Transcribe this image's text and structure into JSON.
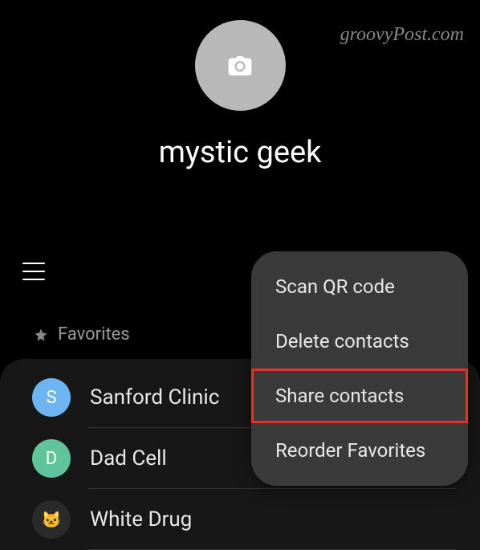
{
  "watermark": "groovyPost.com",
  "profile": {
    "name": "mystic geek"
  },
  "favorites": {
    "label": "Favorites"
  },
  "contacts": [
    {
      "initial": "S",
      "name": "Sanford Clinic",
      "color": "#6db5f0"
    },
    {
      "initial": "D",
      "name": "Dad Cell",
      "color": "#5fc49b"
    },
    {
      "initial": "",
      "name": "White Drug",
      "color": "#2a2a2a"
    }
  ],
  "menu": {
    "items": [
      {
        "label": "Scan QR code"
      },
      {
        "label": "Delete contacts"
      },
      {
        "label": "Share contacts"
      },
      {
        "label": "Reorder Favorites"
      }
    ]
  }
}
